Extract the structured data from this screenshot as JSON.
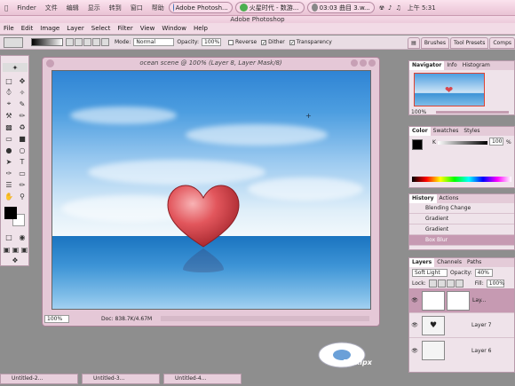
{
  "system_bar": {
    "apple": "",
    "menus": [
      "Finder",
      "文件",
      "编辑",
      "显示",
      "转到",
      "窗口",
      "帮助"
    ],
    "tasks": [
      "Adobe Photosh...",
      "火星时代 - 数游...",
      "03:03 曲目 3.w..."
    ],
    "clock": "上午 5:31"
  },
  "app": {
    "title": "Adobe Photoshop",
    "menu": [
      "File",
      "Edit",
      "Image",
      "Layer",
      "Select",
      "Filter",
      "View",
      "Window",
      "Help"
    ]
  },
  "options": {
    "mode_label": "Mode:",
    "mode_value": "Normal",
    "opacity_label": "Opacity:",
    "opacity_value": "100%",
    "reverse": "Reverse",
    "dither": "Dither",
    "transparency": "Transparency"
  },
  "palette_tabs": [
    "Brushes",
    "Tool Presets",
    "Comps"
  ],
  "document": {
    "title": "ocean scene @ 100% (Layer 8, Layer Mask/8)",
    "zoom": "100%",
    "doc_info": "Doc: 838.7K/4.67M"
  },
  "navigator": {
    "tabs": [
      "Navigator",
      "Info",
      "Histogram"
    ],
    "zoom": "100%"
  },
  "color": {
    "tabs": [
      "Color",
      "Swatches",
      "Styles"
    ],
    "channel": "K",
    "value": "100",
    "percent": "%"
  },
  "history": {
    "tabs": [
      "History",
      "Actions"
    ],
    "items": [
      "Blending Change",
      "Gradient",
      "Gradient",
      "Box Blur"
    ]
  },
  "layers": {
    "tabs": [
      "Layers",
      "Channels",
      "Paths"
    ],
    "blend_mode": "Soft Light",
    "opacity_label": "Opacity:",
    "opacity_value": "40%",
    "lock_label": "Lock:",
    "fill_label": "Fill:",
    "fill_value": "100%",
    "items": [
      "Lay...",
      "Layer 7",
      "Layer 6"
    ]
  },
  "dock": [
    "Untitled-2...",
    "Untitled-3...",
    "Untitled-4..."
  ],
  "watermark": "By xipx",
  "colors": {
    "accent": "#e9c2d4",
    "panel": "#efe3ea",
    "heart": "#d9474e"
  }
}
